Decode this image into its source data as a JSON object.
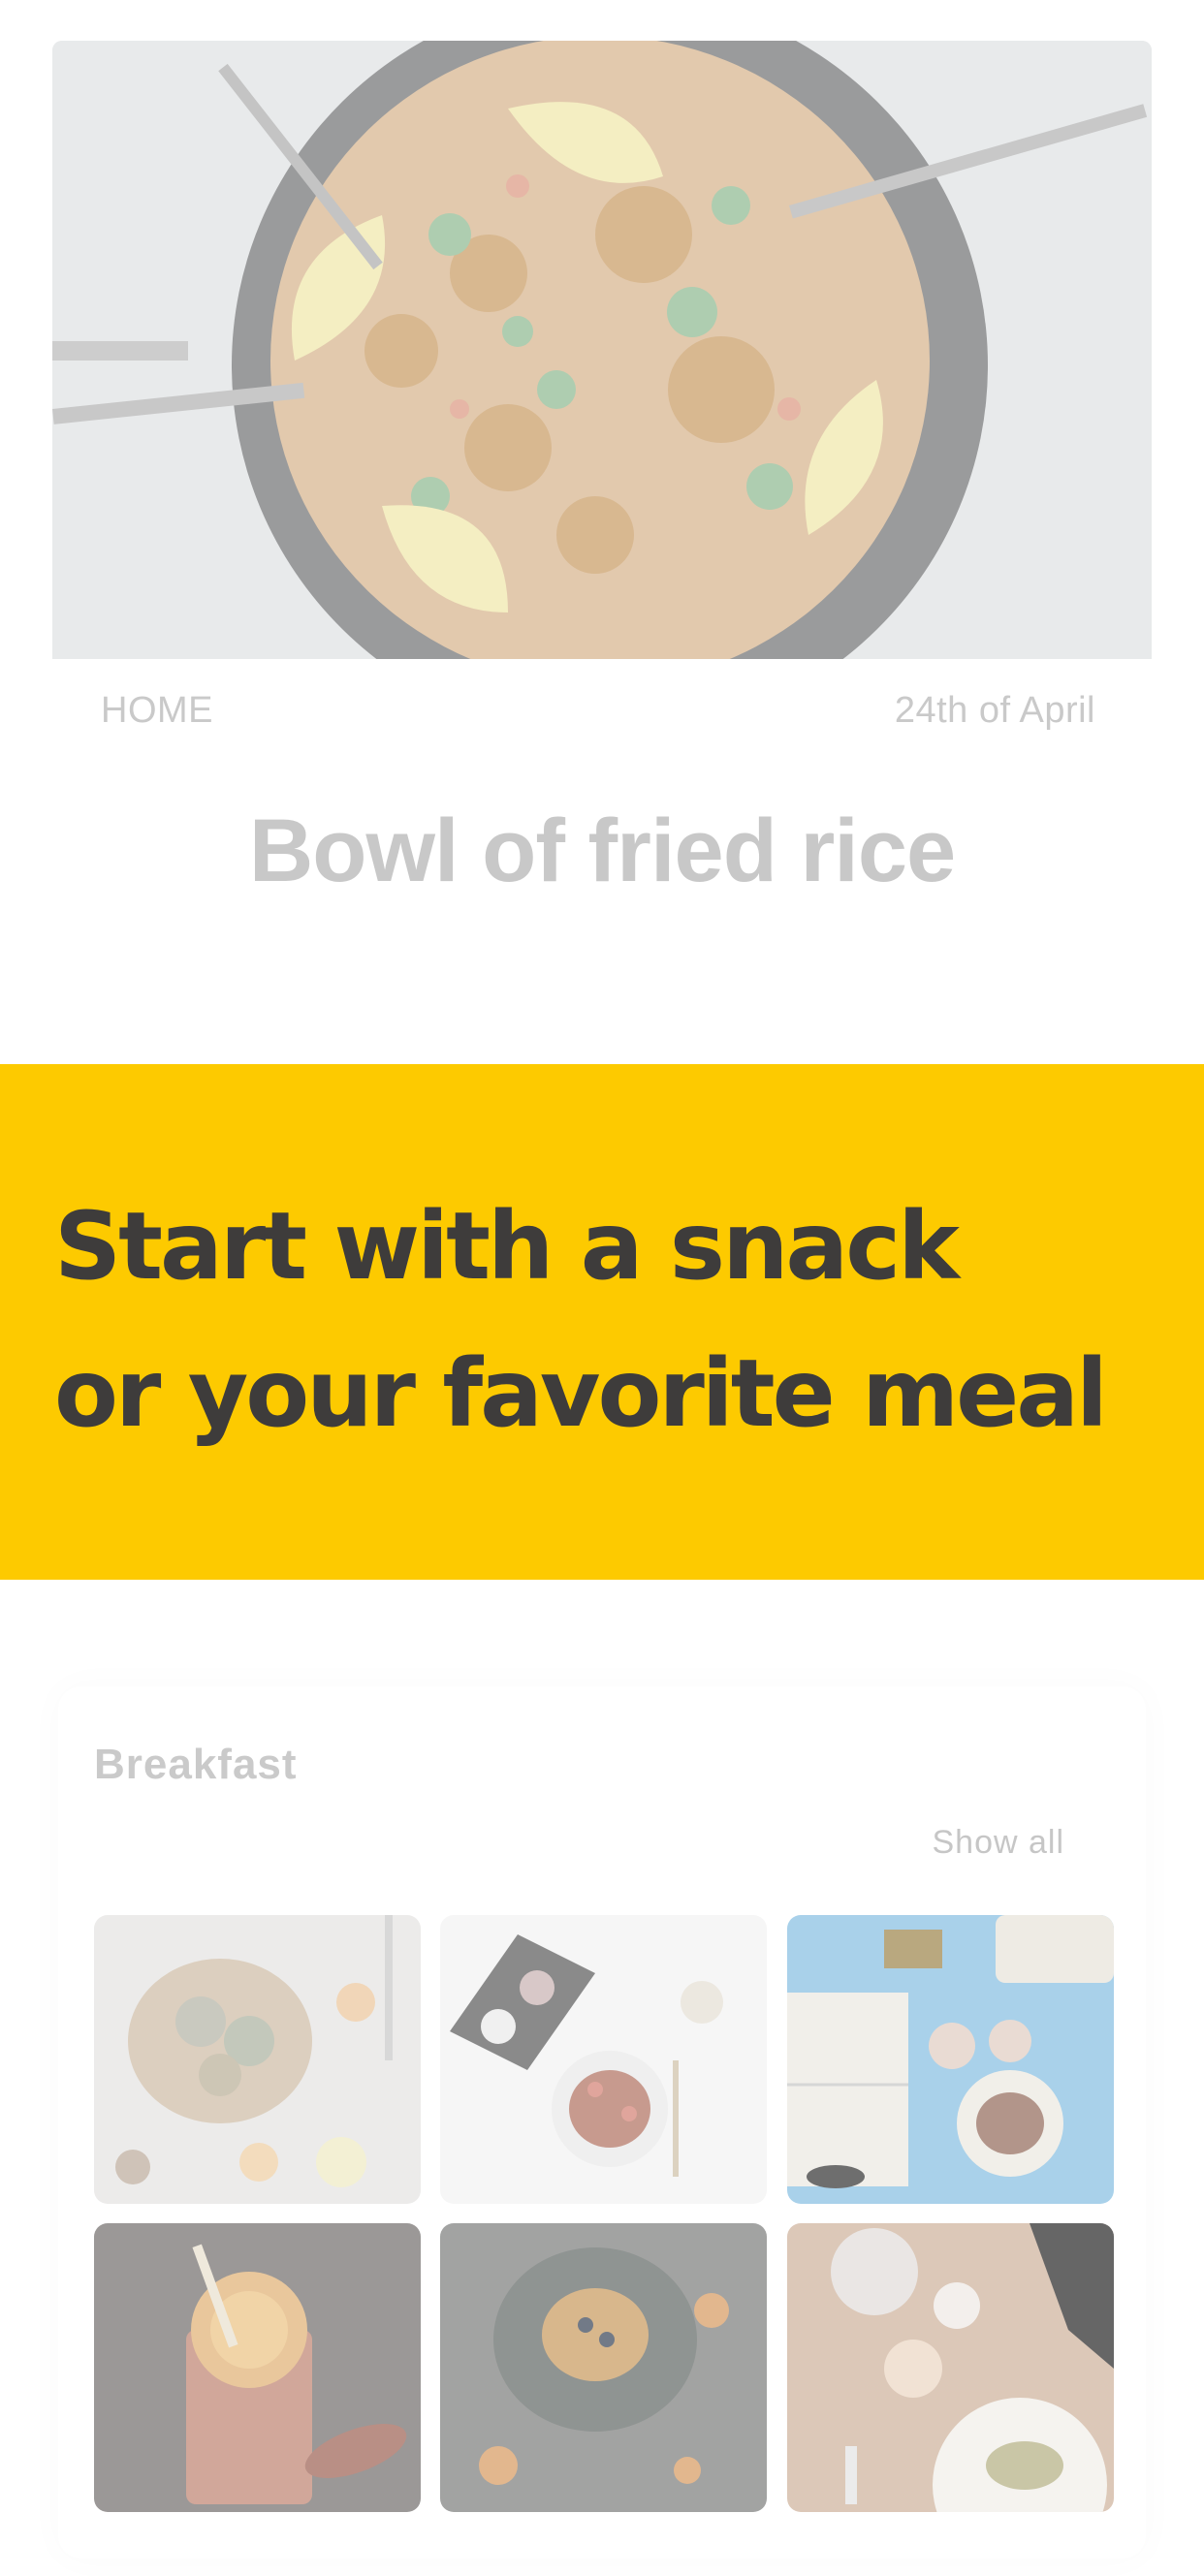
{
  "hero": {
    "image": "fried-rice-pan-photo",
    "category": "HOME",
    "date": "24th of April",
    "title": "Bowl of fried rice"
  },
  "banner": {
    "line1": "Start with a snack",
    "line2": "or your favorite meal",
    "background": "#fdca00",
    "text_color": "#3e3c3b"
  },
  "breakfast": {
    "title": "Breakfast",
    "show_all": "Show all",
    "photos": [
      "breakfast-board-photo",
      "pancake-plate-photo",
      "tea-and-notebook-photo",
      "orange-juice-photo",
      "pancake-stack-photo",
      "teapot-and-toast-photo"
    ]
  }
}
